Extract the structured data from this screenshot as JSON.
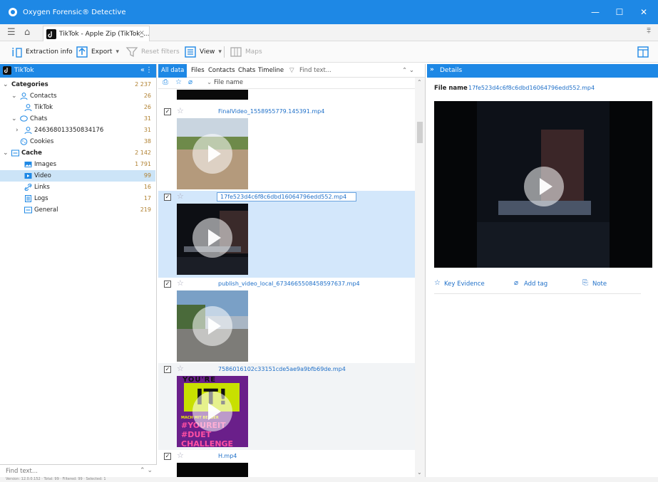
{
  "window": {
    "title": "Oxygen Forensic® Detective",
    "minimize": "—",
    "maximize": "☐",
    "close": "✕"
  },
  "tab": {
    "label": "TikTok - Apple Zip (TikTok_...",
    "close": "×"
  },
  "toolbar": {
    "extraction_info": "Extraction info",
    "export": "Export",
    "reset_filters": "Reset filters",
    "view": "View",
    "maps": "Maps"
  },
  "left_panel": {
    "header": "TikTok",
    "collapse": "«",
    "tree": [
      {
        "label": "Categories",
        "count": "2 237",
        "bold": true
      },
      {
        "label": "Contacts",
        "count": "26"
      },
      {
        "label": "TikTok",
        "count": "26"
      },
      {
        "label": "Chats",
        "count": "31"
      },
      {
        "label": "246368013350834176",
        "count": "31"
      },
      {
        "label": "Cookies",
        "count": "38"
      },
      {
        "label": "Cache",
        "count": "2 142",
        "bold": true
      },
      {
        "label": "Images",
        "count": "1 791"
      },
      {
        "label": "Video",
        "count": "99"
      },
      {
        "label": "Links",
        "count": "16"
      },
      {
        "label": "Logs",
        "count": "17"
      },
      {
        "label": "General",
        "count": "219"
      }
    ],
    "find_placeholder": "Find text..."
  },
  "middle_panel": {
    "tabs": [
      "All data",
      "Files",
      "Contacts",
      "Chats",
      "Timeline"
    ],
    "find_placeholder": "Find text...",
    "column": "File name",
    "items": [
      {
        "filename": "FinalVideo_1558955779.145391.mp4",
        "checked": true,
        "selected": false
      },
      {
        "filename": "17fe523d4c6f8c6dbd16064796edd552.mp4",
        "checked": true,
        "selected": true
      },
      {
        "filename": "publish_video_local_6734665508458597637.mp4",
        "checked": true,
        "selected": false
      },
      {
        "filename": "7586016102c33151cde5ae9a9bfb69de.mp4",
        "checked": true,
        "selected": false,
        "thumb_text": [
          "YOU'RE",
          "IT!",
          "MACH MIT BEI DER",
          "#YOUREIT",
          "#DUET",
          "CHALLENGE"
        ]
      },
      {
        "filename": "H.mp4",
        "checked": true,
        "selected": false
      }
    ]
  },
  "right_panel": {
    "header": "Details",
    "filename_label": "File name",
    "filename_value": "17fe523d4c6f8c6dbd16064796edd552.mp4",
    "key_evidence": "Key Evidence",
    "add_tag": "Add tag",
    "note": "Note"
  },
  "statusbar": "Version: 12.0.0.152 · Total: 99 · Filtered: 99 · Selected: 1",
  "colors": {
    "accent": "#1e88e5",
    "selection": "#cce4f7",
    "link": "#1e6fc8",
    "count": "#b08030"
  }
}
